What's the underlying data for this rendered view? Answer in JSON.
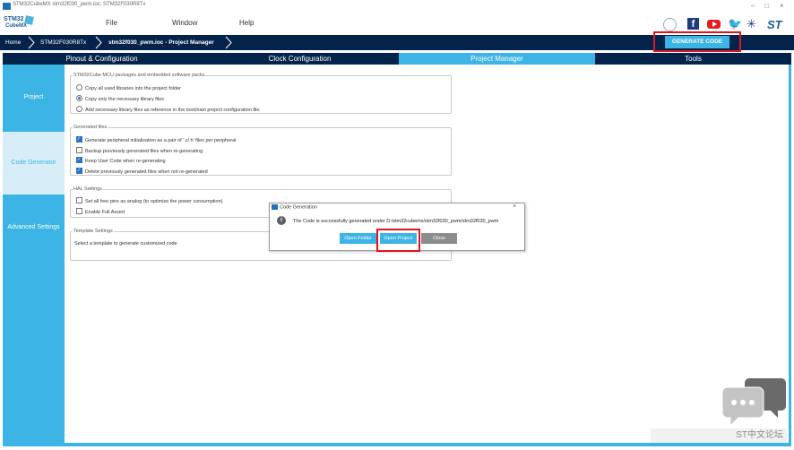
{
  "window": {
    "title": "STM32CubeMX stm32f030_pwm.ioc: STM32F030R8Tx",
    "controls": [
      "–",
      "□",
      "×"
    ]
  },
  "menu": {
    "logo_line1": "STM32",
    "logo_line2": "CubeMX",
    "items": [
      "File",
      "Window",
      "Help"
    ],
    "social_icons": [
      "anniversary-icon",
      "facebook-icon",
      "youtube-icon",
      "twitter-icon",
      "network-icon",
      "st-logo"
    ],
    "facebook_glyph": "f",
    "twitter_glyph": "🐦",
    "network_glyph": "✳",
    "st_logo_text": "ST"
  },
  "breadcrumb": {
    "items": [
      "Home",
      "STM32F030R8Tx",
      "stm32f030_pwm.ioc - Project Manager"
    ],
    "generate_button": "GENERATE CODE"
  },
  "tabs": {
    "items": [
      "Pinout & Configuration",
      "Clock Configuration",
      "Project Manager",
      "Tools"
    ],
    "active": "Project Manager"
  },
  "sidebar": {
    "items": [
      "Project",
      "Code Generator",
      "Advanced Settings"
    ],
    "active": "Code Generator"
  },
  "content": {
    "packages": {
      "legend": "STM32Cube MCU packages and embedded software packs",
      "options": [
        {
          "label": "Copy all used libraries into the project folder",
          "selected": false
        },
        {
          "label": "Copy only the necessary library files",
          "selected": true
        },
        {
          "label": "Add necessary library files as reference in the toolchain project configuration file",
          "selected": false
        }
      ]
    },
    "generated_files": {
      "legend": "Generated files",
      "options": [
        {
          "label": "Generate peripheral initialization as a pair of '.c/.h' files per peripheral",
          "checked": true
        },
        {
          "label": "Backup previously generated files when re-generating",
          "checked": false
        },
        {
          "label": "Keep User Code when re-generating",
          "checked": true
        },
        {
          "label": "Delete previously generated files when not re-generated",
          "checked": true
        }
      ]
    },
    "hal": {
      "legend": "HAL Settings",
      "options": [
        {
          "label": "Set all free pins as analog (to optimize the power consumption)",
          "checked": false
        },
        {
          "label": "Enable Full Assert",
          "checked": false
        }
      ]
    },
    "template": {
      "legend": "Template Settings",
      "text": "Select a template to generate customized code"
    }
  },
  "dialog": {
    "title": "Code Generation",
    "close": "×",
    "info_glyph": "i",
    "message": "The Code is successfully generated under D:/stm32cubemx/stm32f030_pwm/stm32f030_pwm",
    "buttons": [
      "Open Folder",
      "Open Project",
      "Close"
    ]
  },
  "watermark": "ST中文论坛",
  "colors": {
    "navy": "#03234b",
    "accent": "#3cb4e6",
    "highlight": "#e0141e"
  }
}
